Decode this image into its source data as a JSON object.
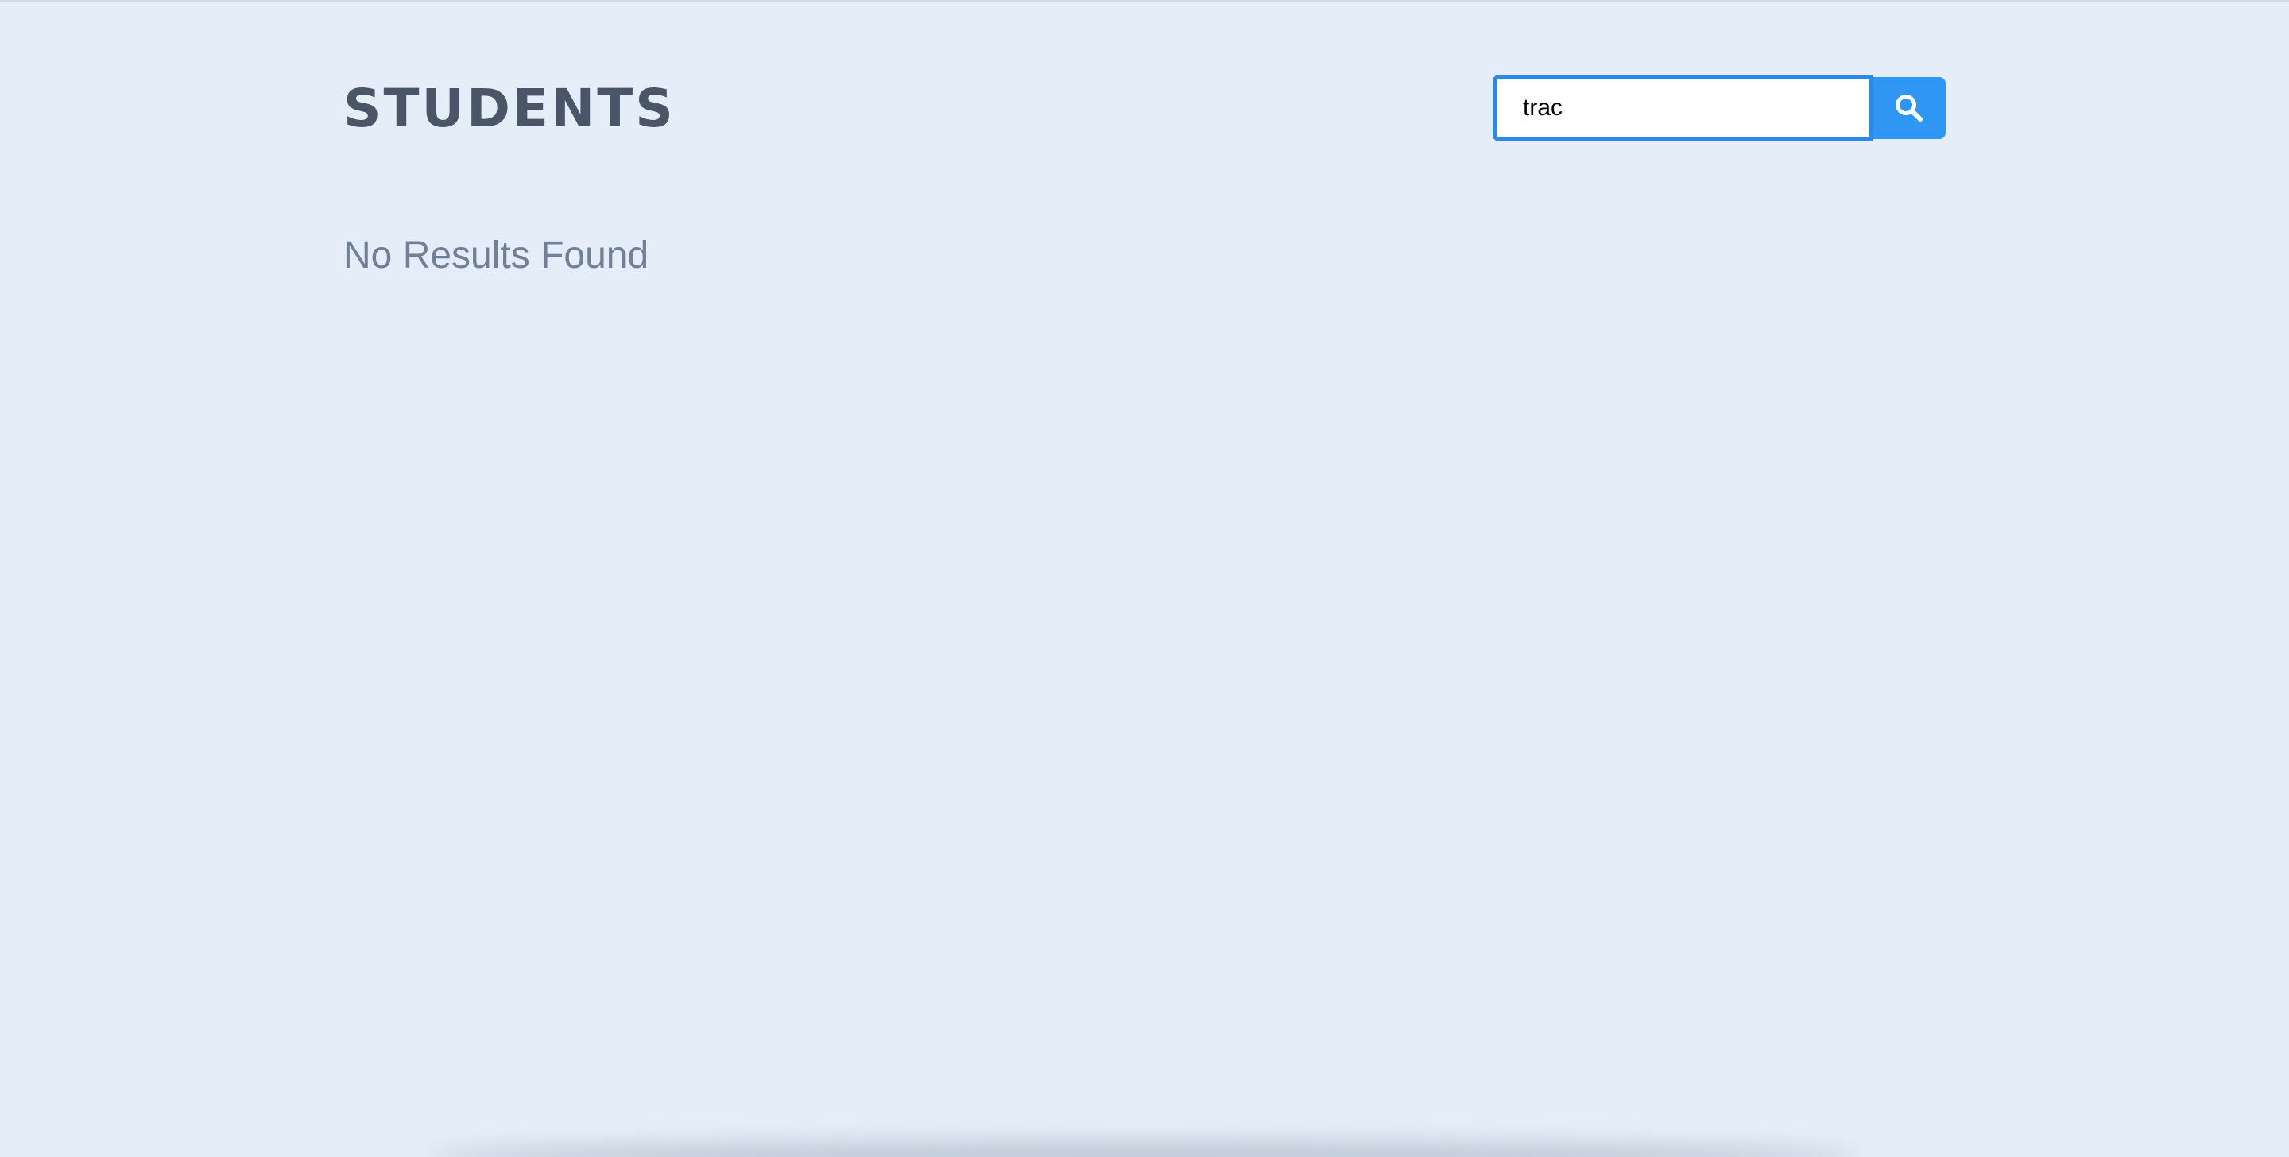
{
  "header": {
    "title": "STUDENTS"
  },
  "search": {
    "value": "trac",
    "button_icon": "search-icon"
  },
  "results": {
    "empty_message": "No Results Found"
  },
  "colors": {
    "background": "#e5eef8",
    "title": "#4a5568",
    "accent": "#3096f4",
    "muted_text": "#718096"
  }
}
